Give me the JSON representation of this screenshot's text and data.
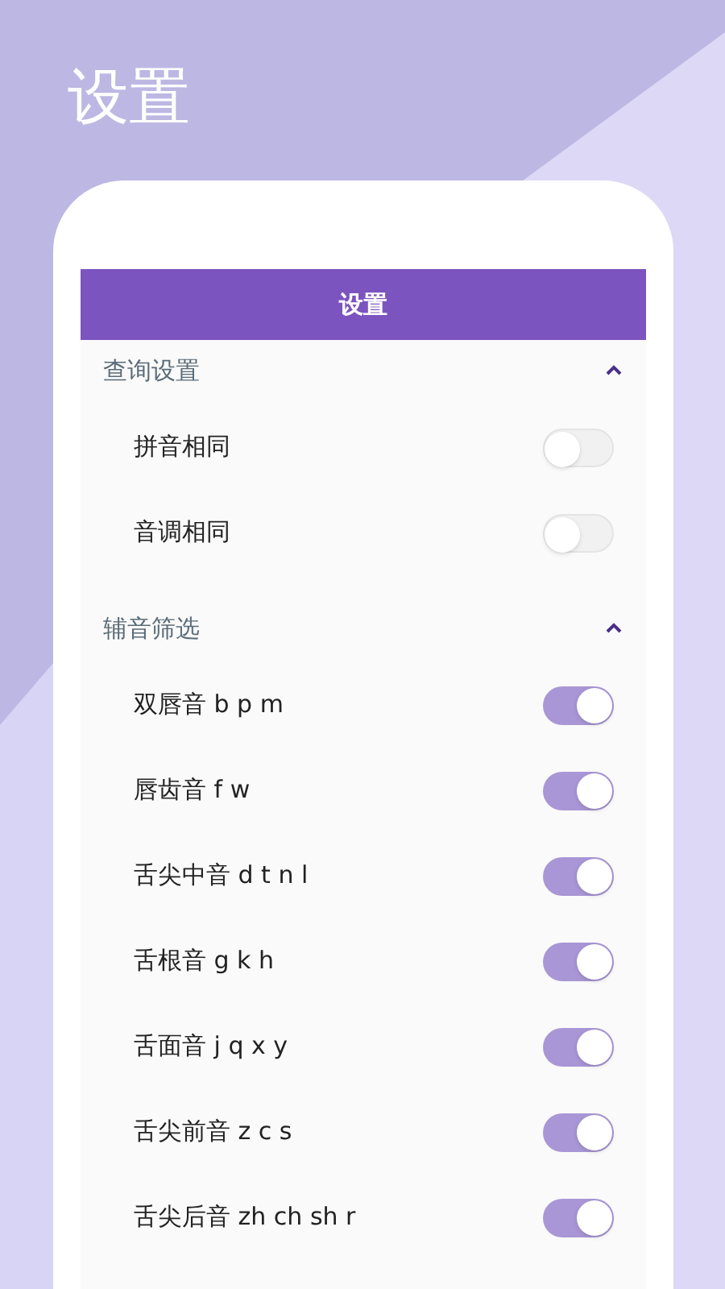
{
  "page_title": "设置",
  "app_bar": {
    "title": "设置"
  },
  "sections": [
    {
      "title": "查询设置",
      "expanded": true,
      "items": [
        {
          "label": "拼音相同",
          "on": false
        },
        {
          "label": "音调相同",
          "on": false
        }
      ]
    },
    {
      "title": "辅音筛选",
      "expanded": true,
      "items": [
        {
          "label": "双唇音 b p m",
          "on": true
        },
        {
          "label": "唇齿音 f w",
          "on": true
        },
        {
          "label": "舌尖中音 d t n l",
          "on": true
        },
        {
          "label": "舌根音 g k h",
          "on": true
        },
        {
          "label": "舌面音 j q x y",
          "on": true
        },
        {
          "label": "舌尖前音 z c s",
          "on": true
        },
        {
          "label": "舌尖后音 zh ch sh r",
          "on": true
        }
      ]
    }
  ]
}
